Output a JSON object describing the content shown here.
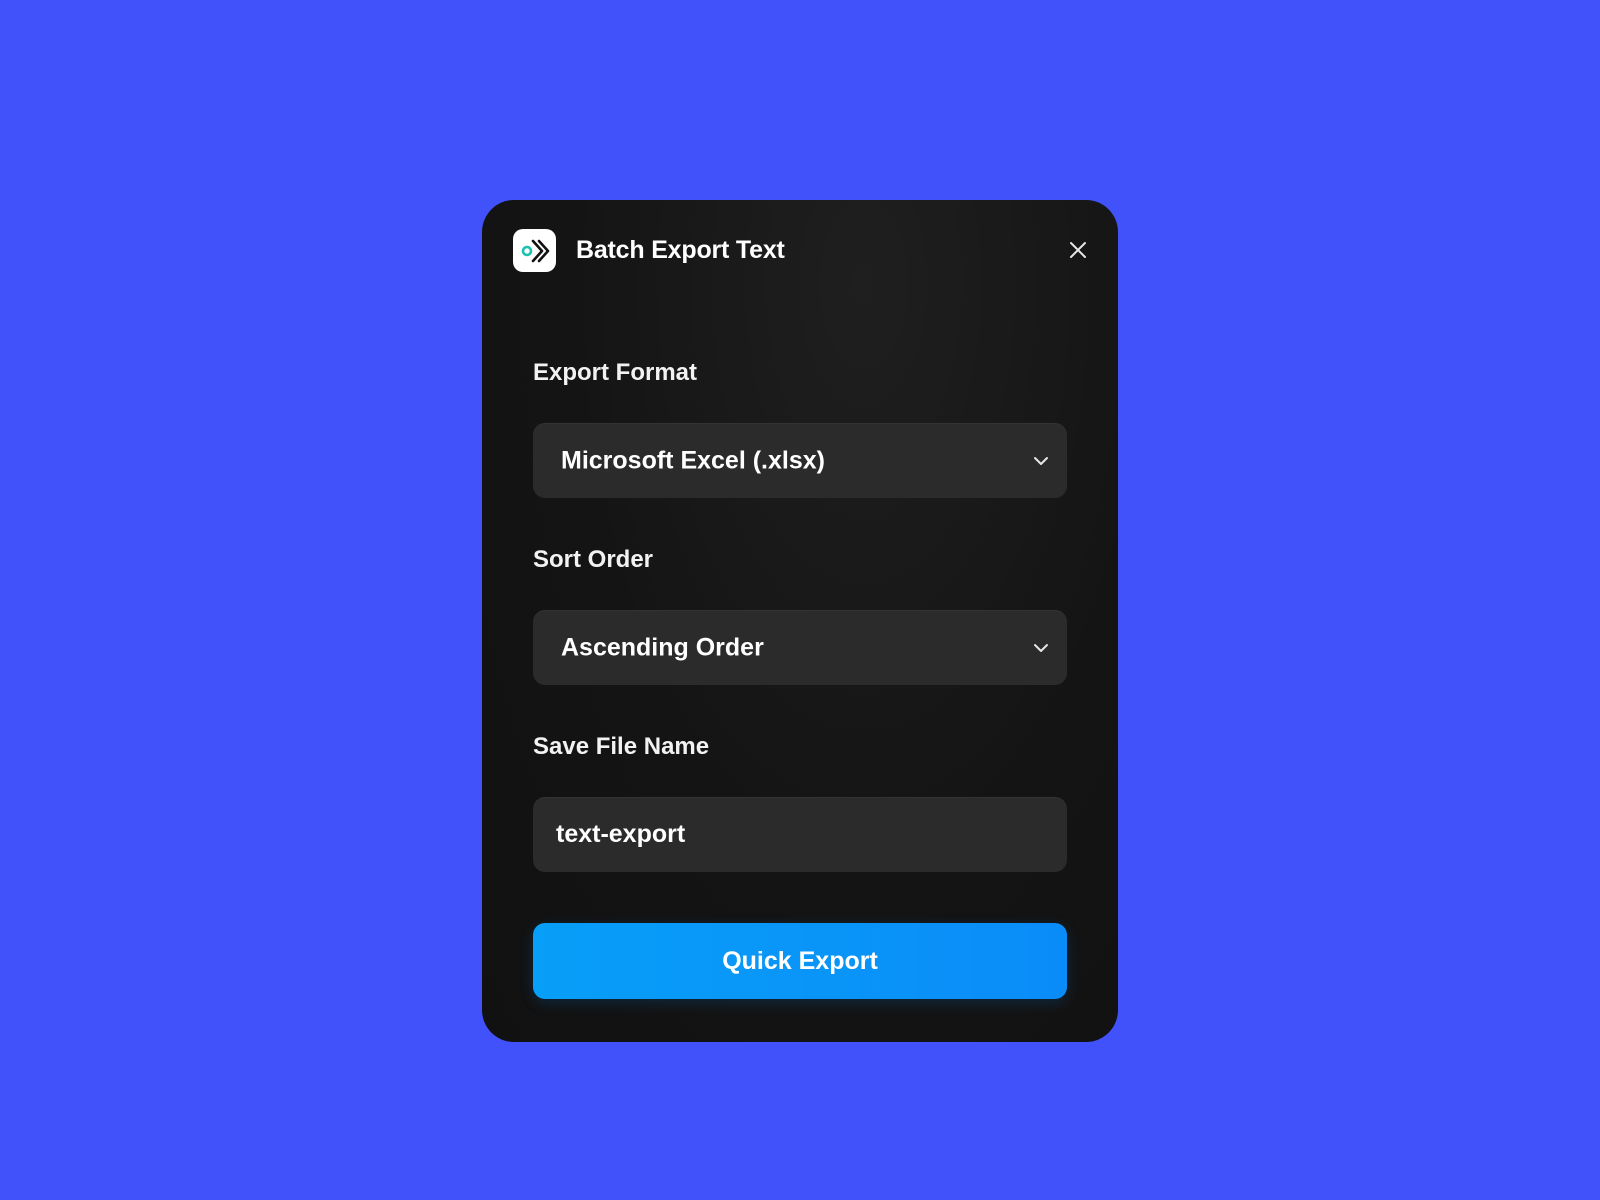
{
  "dialog": {
    "title": "Batch Export Text",
    "icon": "export-arrow-icon",
    "close_icon": "close-icon"
  },
  "export_format": {
    "label": "Export Format",
    "selected": "Microsoft Excel (.xlsx)"
  },
  "sort_order": {
    "label": "Sort Order",
    "selected": "Ascending Order"
  },
  "file_name": {
    "label": "Save File Name",
    "value": "text-export"
  },
  "actions": {
    "export_label": "Quick Export"
  },
  "colors": {
    "background": "#4152fb",
    "dialog": "#141414",
    "field": "#2b2b2b",
    "accent": "#0a95f8",
    "icon_teal": "#1cc3b2"
  }
}
